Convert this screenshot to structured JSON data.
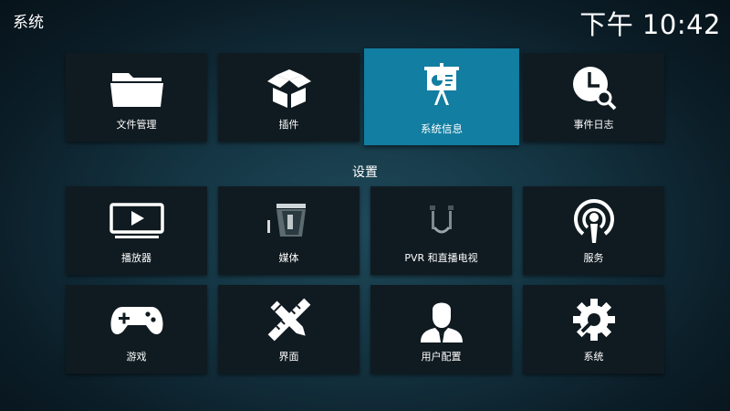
{
  "header": {
    "title": "系统",
    "clock": "下午 10:42"
  },
  "top_row": [
    {
      "label": "文件管理",
      "icon": "folder-icon"
    },
    {
      "label": "插件",
      "icon": "addons-box-icon"
    },
    {
      "label": "系统信息",
      "icon": "presentation-icon",
      "focused": true
    },
    {
      "label": "事件日志",
      "icon": "clock-search-icon"
    }
  ],
  "section": {
    "label": "设置"
  },
  "settings": [
    {
      "label": "播放器",
      "icon": "player-icon"
    },
    {
      "label": "媒体",
      "icon": "media-icon"
    },
    {
      "label": "PVR 和直播电视",
      "icon": "pvr-icon"
    },
    {
      "label": "服务",
      "icon": "podcast-icon"
    },
    {
      "label": "游戏",
      "icon": "gamepad-icon"
    },
    {
      "label": "界面",
      "icon": "pencil-ruler-icon"
    },
    {
      "label": "用户配置",
      "icon": "user-icon"
    },
    {
      "label": "系统",
      "icon": "gear-wrench-icon"
    }
  ],
  "colors": {
    "focus": "#127ea1",
    "tile": "#101b21",
    "background": "#143442"
  }
}
